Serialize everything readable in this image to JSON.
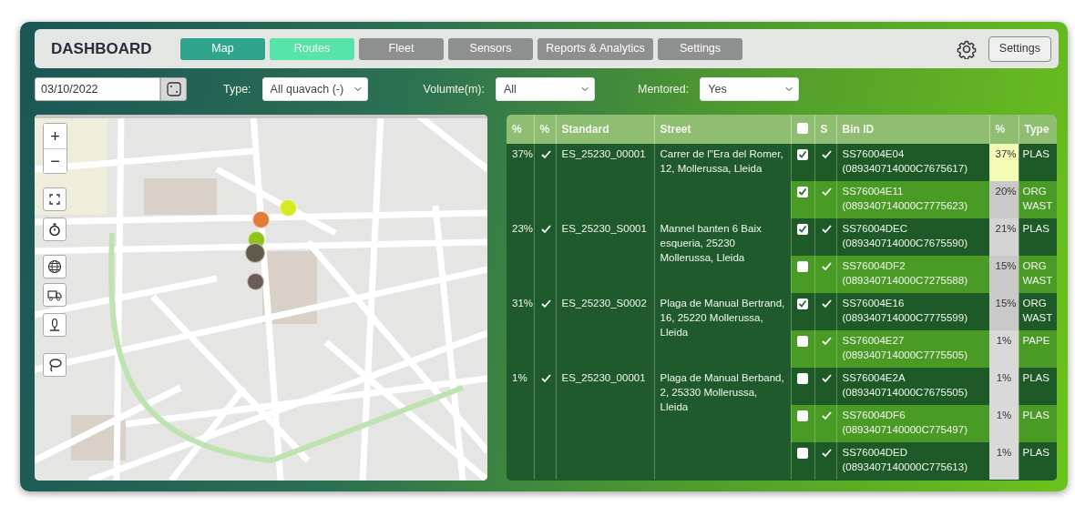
{
  "header": {
    "title": "DASHBOARD",
    "settings_button": "Settings"
  },
  "tabs": [
    {
      "label": "Map",
      "selected": true,
      "highlighted": false
    },
    {
      "label": "Routes",
      "selected": false,
      "highlighted": true
    },
    {
      "label": "Fleet",
      "selected": false,
      "highlighted": false
    },
    {
      "label": "Sensors",
      "selected": false,
      "highlighted": false
    },
    {
      "label": "Reports & Analytics",
      "selected": false,
      "highlighted": false
    },
    {
      "label": "Settings",
      "selected": false,
      "highlighted": false
    }
  ],
  "filters": {
    "date": "03/10/2022",
    "type_label": "Type:",
    "type_value": "All quavach (-)",
    "volume_label": "Volumte(m):",
    "volume_value": "All",
    "mentored_label": "Mentored:",
    "mentored_value": "Yes"
  },
  "map": {
    "zoom_in": "+",
    "zoom_out": "−",
    "markers": [
      {
        "color": "#d9e825"
      },
      {
        "color": "#e07b3c"
      },
      {
        "color": "#8fc41c"
      },
      {
        "color": "#5f5b47"
      },
      {
        "color": "#6a5c57"
      }
    ]
  },
  "table": {
    "columns": [
      "%",
      "%",
      "Standard",
      "Street",
      "S",
      "Bin ID",
      "%",
      "Type"
    ],
    "select_all_checked": false,
    "groups": [
      {
        "pct": "37%",
        "flag": true,
        "standard": "ES_25230_00001",
        "street": "Carrer de l\"Era del Romer, 12, Mollerussa, Lleida",
        "bins": [
          {
            "checked": true,
            "s": true,
            "id": "SS76004E04",
            "code": "(089340714000C7675617)",
            "pct": "37%",
            "color": "#f3fbb4",
            "type": "PLAS"
          },
          {
            "checked": true,
            "s": true,
            "id": "SS76004E11",
            "code": "(089340714000C7775623)",
            "pct": "20%",
            "color": "#c9c9c9",
            "type": "ORG WAST"
          }
        ]
      },
      {
        "pct": "23%",
        "flag": true,
        "standard": "ES_25230_S0001",
        "street": "Mannel banten 6 Baix esqueria, 25230 Mollerussa, Lleida",
        "bins": [
          {
            "checked": true,
            "s": true,
            "id": "SS76004DEC",
            "code": "(089340714000C7675590)",
            "pct": "21%",
            "color": "#d4d4d4",
            "type": "PLAS"
          },
          {
            "checked": false,
            "s": true,
            "id": "SS76004DF2",
            "code": "(089340714000C7275588)",
            "pct": "15%",
            "color": "#c9c9c9",
            "type": "ORG WAST"
          }
        ]
      },
      {
        "pct": "31%",
        "flag": true,
        "standard": "ES_25230_S0002",
        "street": "Plaga de Manual Bertrand, 16, 25220 Mollerussa, Lleida",
        "bins": [
          {
            "checked": true,
            "s": true,
            "id": "SS76004E16",
            "code": "(089340714000C7775599)",
            "pct": "15%",
            "color": "#c9c9c9",
            "type": "ORG WAST"
          },
          {
            "checked": false,
            "s": true,
            "id": "SS76004E27",
            "code": "(089340714000C7775505)",
            "pct": "1%",
            "color": "#d9d9d9",
            "type": "PAPE"
          }
        ]
      },
      {
        "pct": "1%",
        "flag": true,
        "standard": "ES_25230_00001",
        "street": "Plaga de Manual Berband, 2, 25330 Mollerussa, Lleida",
        "bins": [
          {
            "checked": false,
            "s": true,
            "id": "SS76004E2A",
            "code": "(089340714000C7675505)",
            "pct": "1%",
            "color": "#d9d9d9",
            "type": "PLAS"
          },
          {
            "checked": false,
            "s": true,
            "id": "SS76004DF6",
            "code": "(0893407140000C775497)",
            "pct": "1%",
            "color": "#d9d9d9",
            "type": "PLAS"
          },
          {
            "checked": false,
            "s": true,
            "id": "SS76004DED",
            "code": "(0893407140000C775613)",
            "pct": "1%",
            "color": "#d9d9d9",
            "type": "PLAS"
          }
        ]
      }
    ]
  }
}
